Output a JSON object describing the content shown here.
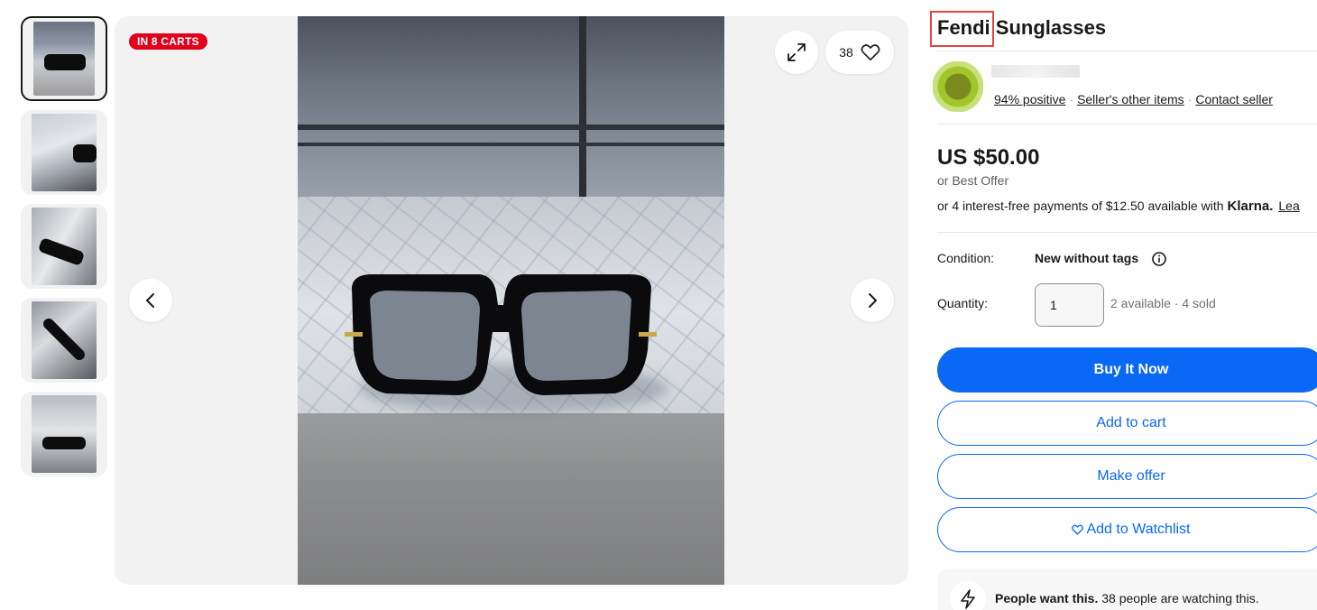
{
  "badge": "IN 8 CARTS",
  "watch_count": "38",
  "thumbnails": [
    {
      "alt": "Sunglasses thumbnail 1"
    },
    {
      "alt": "Sunglasses thumbnail 2"
    },
    {
      "alt": "Sunglasses thumbnail 3"
    },
    {
      "alt": "Sunglasses thumbnail 4"
    },
    {
      "alt": "Sunglasses thumbnail 5"
    }
  ],
  "listing": {
    "title_brand": "Fendi",
    "title_rest": " Sunglasses"
  },
  "seller": {
    "positive": "94% positive",
    "other_items": "Seller's other items",
    "contact": "Contact seller"
  },
  "price": {
    "amount": "US $50.00",
    "best_offer": "or Best Offer",
    "klarna_text": "or 4 interest-free payments of $12.50 available with",
    "klarna_brand": "Klarna.",
    "klarna_link": "Lea"
  },
  "condition": {
    "label": "Condition:",
    "value": "New without tags"
  },
  "quantity": {
    "label": "Quantity:",
    "value": "1",
    "info": "2 available · 4 sold"
  },
  "actions": {
    "buy_now": "Buy It Now",
    "add_to_cart": "Add to cart",
    "make_offer": "Make offer",
    "watchlist": "Add to Watchlist"
  },
  "promo": {
    "bold": "People want this.",
    "text": " 38 people are watching this."
  },
  "colors": {
    "primary": "#0968f6",
    "badge": "#e0001b",
    "highlight": "#e8433f"
  },
  "icons": [
    "expand-icon",
    "heart-icon",
    "chevron-left-icon",
    "chevron-right-icon",
    "info-icon",
    "lightning-icon"
  ]
}
